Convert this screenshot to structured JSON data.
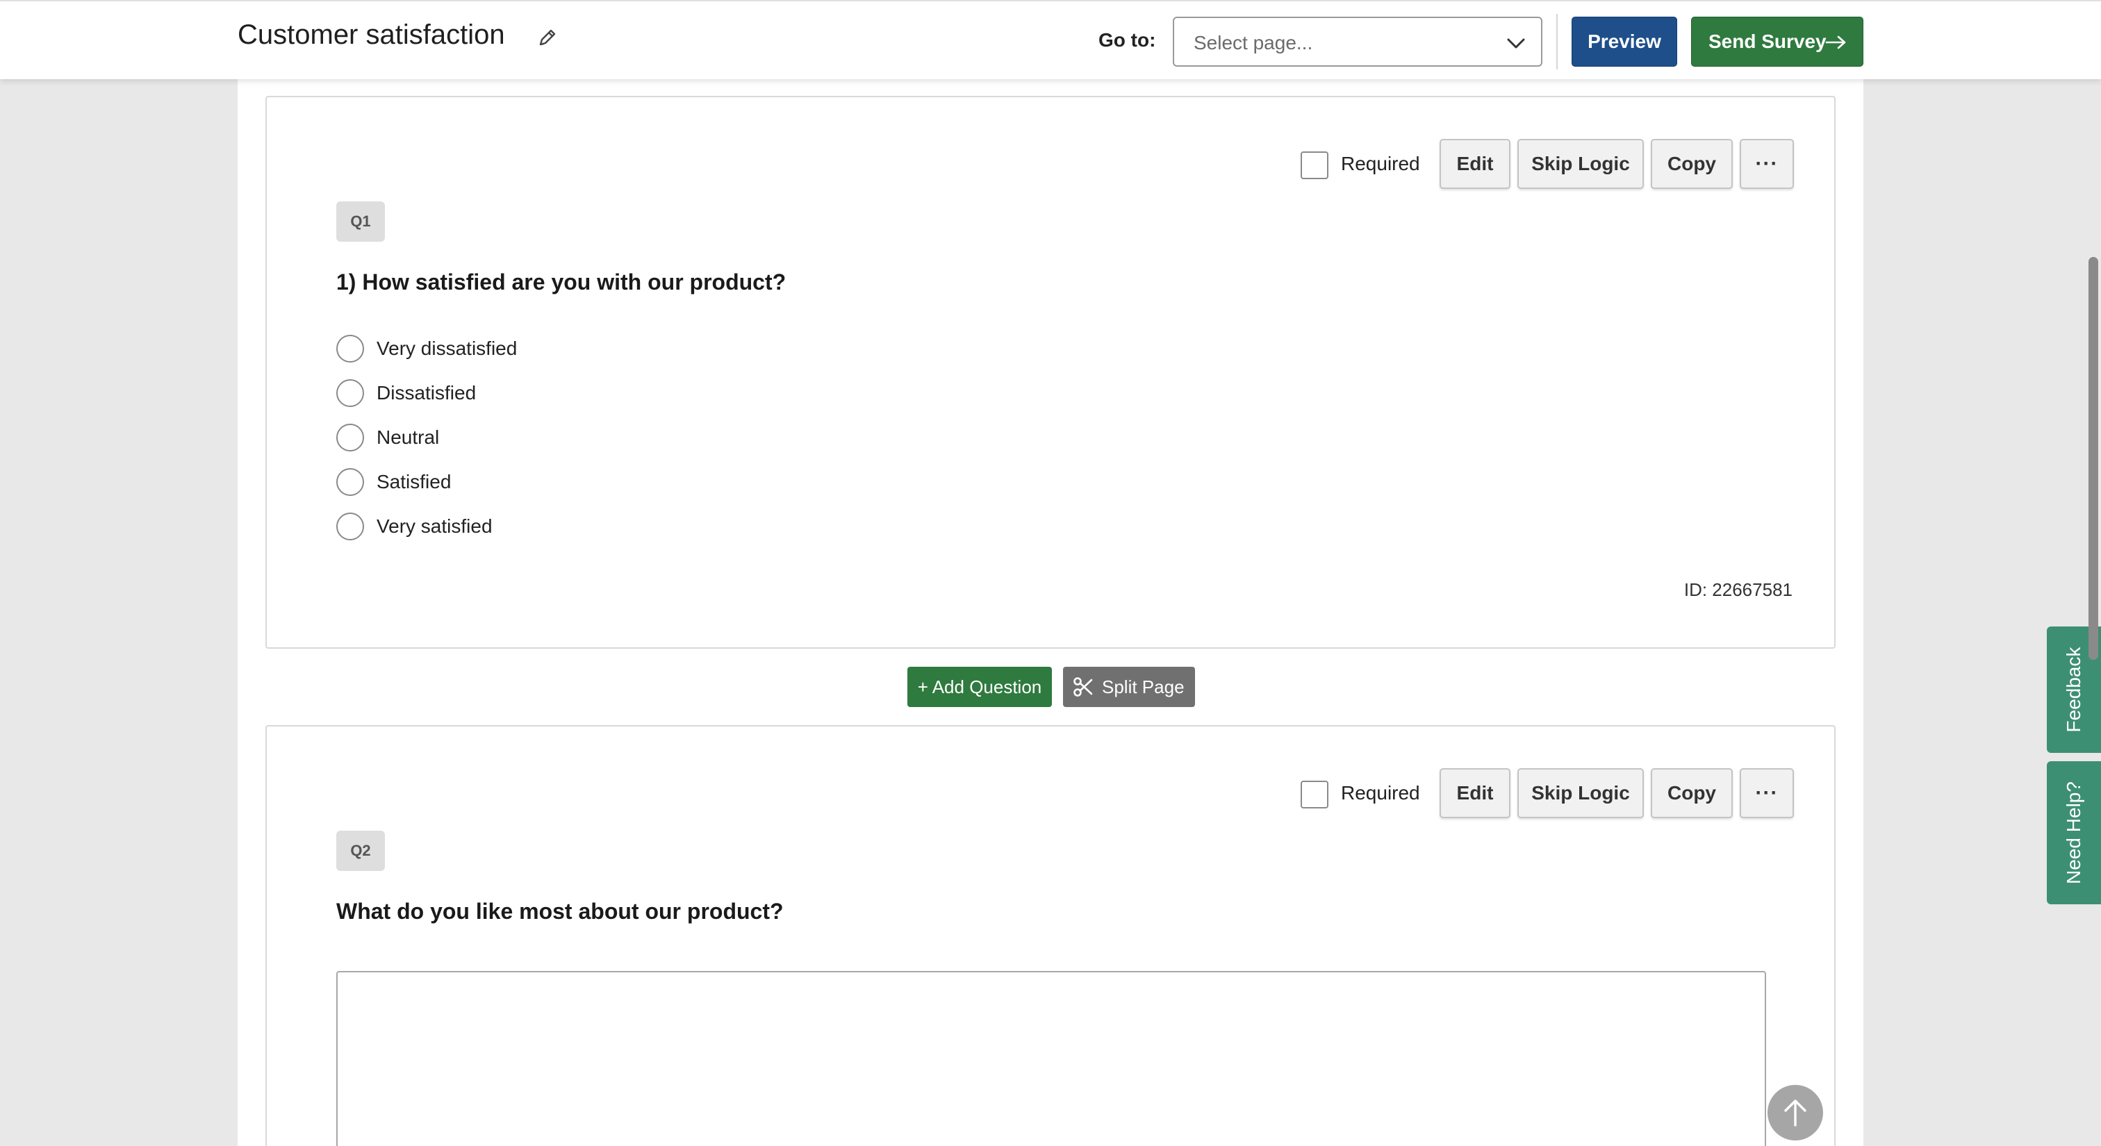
{
  "header": {
    "title": "Customer satisfaction",
    "goto_label": "Go to:",
    "page_select_placeholder": "Select page...",
    "preview_label": "Preview",
    "send_label": "Send Survey"
  },
  "questions": [
    {
      "badge": "Q1",
      "text": "1) How satisfied are you with our product?",
      "required_label": "Required",
      "edit_label": "Edit",
      "skip_logic_label": "Skip Logic",
      "copy_label": "Copy",
      "more_label": "···",
      "options": [
        "Very dissatisfied",
        "Dissatisfied",
        "Neutral",
        "Satisfied",
        "Very satisfied"
      ],
      "id_text": "ID: 22667581"
    },
    {
      "badge": "Q2",
      "text": "What do you like most about our product?",
      "required_label": "Required",
      "edit_label": "Edit",
      "skip_logic_label": "Skip Logic",
      "copy_label": "Copy",
      "more_label": "···"
    }
  ],
  "actions": {
    "add_question_label": "+ Add Question",
    "split_page_label": "Split Page"
  },
  "side_tabs": {
    "feedback_label": "Feedback",
    "help_label": "Need Help?"
  },
  "colors": {
    "primary_blue": "#1e4f8a",
    "send_green": "#2f7a3f",
    "side_tab_teal": "#3d8f73",
    "split_gray": "#707070"
  }
}
